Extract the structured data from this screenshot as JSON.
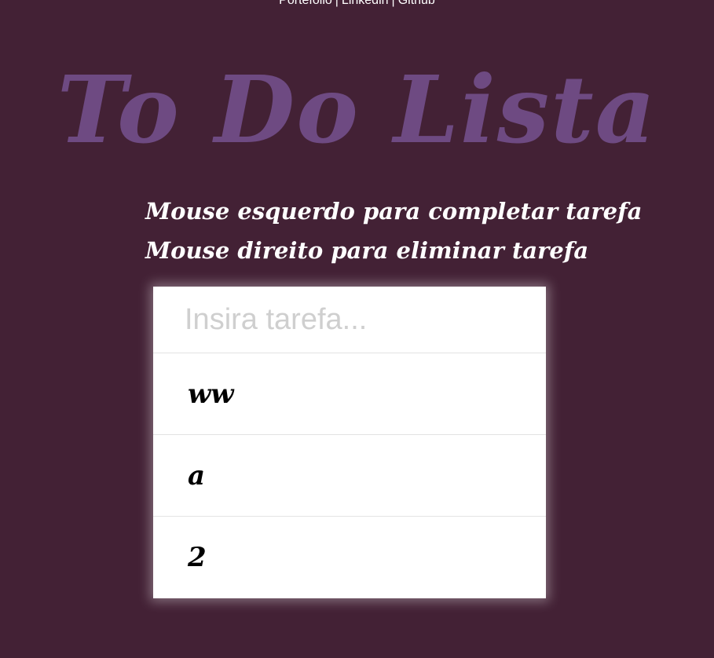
{
  "nav": {
    "links": [
      "Portefolio",
      "Linkedin",
      "Github"
    ],
    "separator": "|"
  },
  "title": "To Do Lista",
  "instructions": [
    "Mouse esquerdo para completar tarefa",
    "Mouse direito para eliminar tarefa"
  ],
  "input": {
    "placeholder": "Insira tarefa...",
    "value": ""
  },
  "tasks": [
    "ww",
    "a",
    "2"
  ],
  "colors": {
    "background": "#432135",
    "title": "#6e4a82",
    "card": "#ffffff"
  }
}
